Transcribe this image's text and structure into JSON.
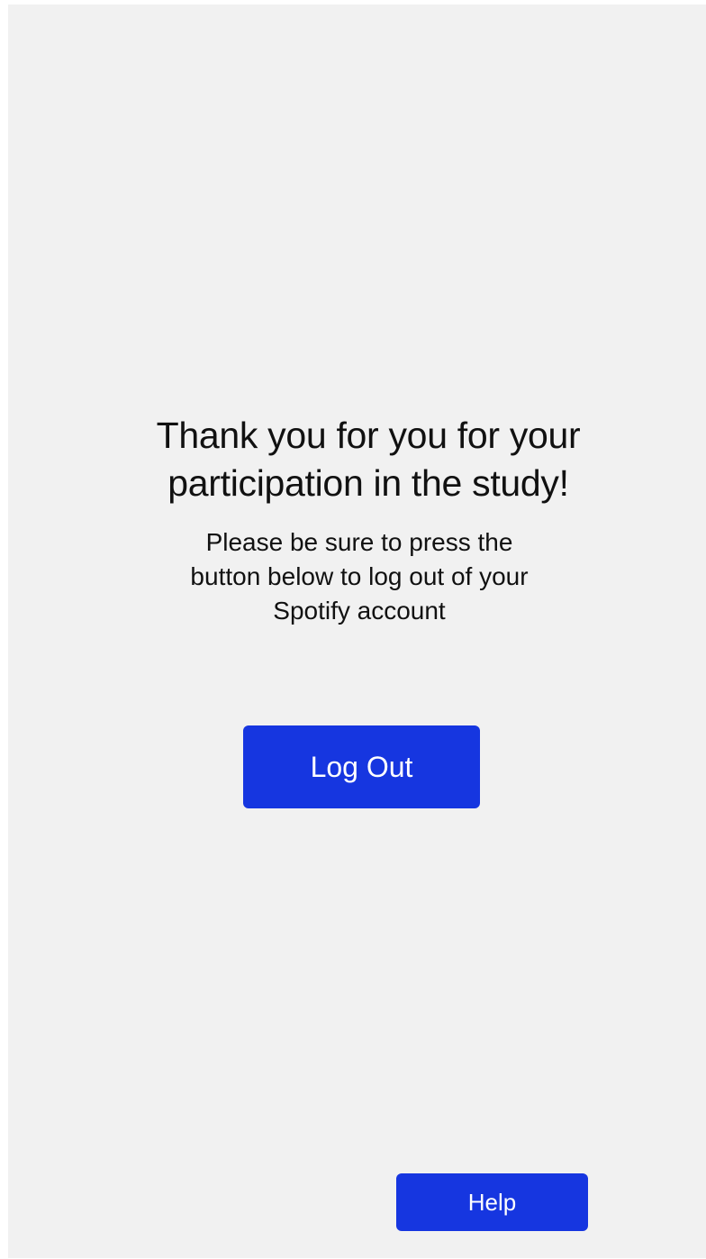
{
  "colors": {
    "background": "#f1f1f1",
    "button": "#1636e0",
    "button_text": "#ffffff",
    "text": "#111111"
  },
  "heading": {
    "line1": "Thank you for you for your",
    "line2": "participation in the study!"
  },
  "message": {
    "line1": "Please be sure to press the",
    "line2": "button below to log out of your",
    "line3": "Spotify account"
  },
  "buttons": {
    "logout_label": "Log Out",
    "help_label": "Help"
  }
}
